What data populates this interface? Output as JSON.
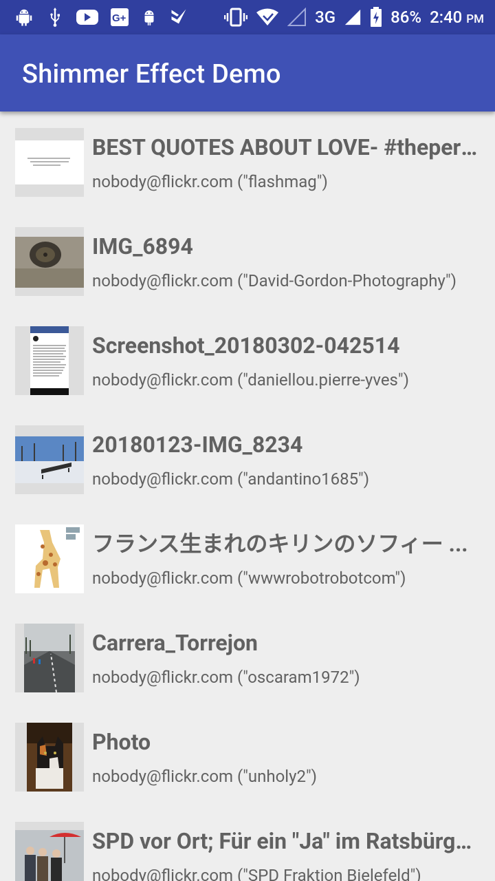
{
  "status_bar": {
    "battery_percent": "86%",
    "network_type": "3G",
    "time": "2:40",
    "ampm": "PM",
    "icons": [
      "android-debug-icon",
      "usb-icon",
      "youtube-icon",
      "google-plus-icon",
      "android-icon",
      "task-check-icon",
      "vibrate-icon",
      "wifi-icon",
      "signal-empty-icon",
      "signal-icon",
      "battery-charging-icon"
    ]
  },
  "app_bar": {
    "title": "Shimmer Effect Demo"
  },
  "items": [
    {
      "title": "BEST QUOTES ABOUT LOVE- #theperfect...",
      "subtitle": "nobody@flickr.com (\"flashmag\")"
    },
    {
      "title": "IMG_6894",
      "subtitle": "nobody@flickr.com (\"David-Gordon-Photography\")"
    },
    {
      "title": "Screenshot_20180302-042514",
      "subtitle": "nobody@flickr.com (\"daniellou.pierre-yves\")"
    },
    {
      "title": "20180123-IMG_8234",
      "subtitle": "nobody@flickr.com (\"andantino1685\")"
    },
    {
      "title": "フランス生まれのキリンのソフィー ...",
      "subtitle": "nobody@flickr.com (\"wwwrobotrobotcom\")"
    },
    {
      "title": "Carrera_Torrejon",
      "subtitle": "nobody@flickr.com (\"oscaram1972\")"
    },
    {
      "title": "Photo",
      "subtitle": "nobody@flickr.com (\"unholy2\")"
    },
    {
      "title": "SPD vor Ort; Für ein \"Ja\" im Ratsbürgerentscheid",
      "subtitle": "nobody@flickr.com (\"SPD Fraktion Bielefeld\")"
    }
  ]
}
